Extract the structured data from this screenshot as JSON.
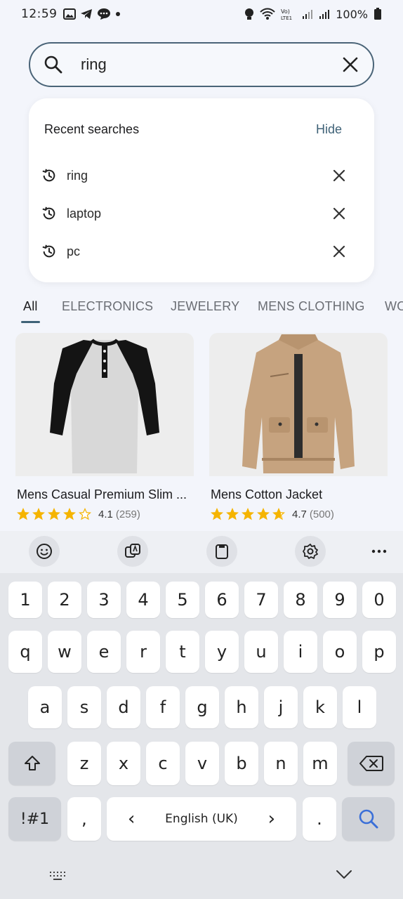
{
  "status_bar": {
    "time": "12:59",
    "battery": "100%"
  },
  "search": {
    "query": "ring"
  },
  "recent": {
    "heading": "Recent searches",
    "hide_label": "Hide",
    "items": [
      {
        "label": "ring"
      },
      {
        "label": "laptop"
      },
      {
        "label": "pc"
      }
    ]
  },
  "tabs": [
    {
      "label": "All",
      "active": true
    },
    {
      "label": "ELECTRONICS"
    },
    {
      "label": "JEWELERY"
    },
    {
      "label": "MENS CLOTHING"
    },
    {
      "label": "WO"
    }
  ],
  "products": [
    {
      "title": "Mens Casual Premium Slim ...",
      "rating": "4.1",
      "count": "(259)",
      "stars": 4.1
    },
    {
      "title": "Mens Cotton Jacket",
      "rating": "4.7",
      "count": "(500)",
      "stars": 4.7
    }
  ],
  "keyboard": {
    "row_numbers": [
      "1",
      "2",
      "3",
      "4",
      "5",
      "6",
      "7",
      "8",
      "9",
      "0"
    ],
    "row_q": [
      "q",
      "w",
      "e",
      "r",
      "t",
      "y",
      "u",
      "i",
      "o",
      "p"
    ],
    "row_a": [
      "a",
      "s",
      "d",
      "f",
      "g",
      "h",
      "j",
      "k",
      "l"
    ],
    "row_z": [
      "z",
      "x",
      "c",
      "v",
      "b",
      "n",
      "m"
    ],
    "symbols": "!#1",
    "comma": ",",
    "language": "English (UK)",
    "period": ".",
    "prev_arrow": "‹",
    "next_arrow": "›"
  },
  "colors": {
    "accent": "#3f6277",
    "star": "#f5b400",
    "search_key": "#3a6fd8"
  }
}
